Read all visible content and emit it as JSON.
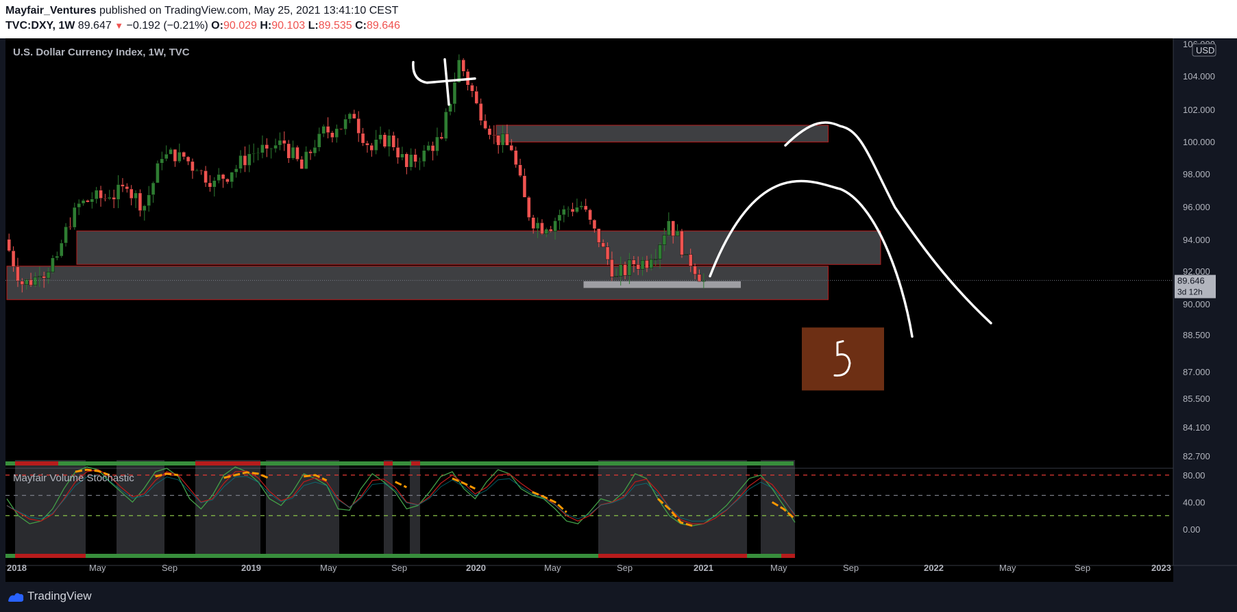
{
  "header": {
    "author": "Mayfair_Ventures",
    "published": " published on TradingView.com, May 25, 2021 13:41:10 CEST",
    "symbol": "TVC:DXY, 1W",
    "last": "89.647",
    "change_arrow": "▼",
    "change": "−0.192 (−0.21%)",
    "o_label": "O:",
    "o_value": "90.029",
    "h_label": "H:",
    "h_value": "90.103",
    "l_label": "L:",
    "l_value": "89.535",
    "c_label": "C:",
    "c_value": "89.646"
  },
  "chart_title": "U.S. Dollar Currency Index, 1W, TVC",
  "indicator_title": "Mayfair Volume Stochastic",
  "footer": {
    "brand": "TradingView"
  },
  "colors": {
    "background": "#131722",
    "up": "#26a69a",
    "up_candle": "#2e7d32",
    "down": "#ef5350",
    "zone_fill": "rgba(178,181,190,0.35)",
    "orange": "#ff9800",
    "brown_box": "#6d2f14"
  },
  "chart_data": [
    {
      "type": "candlestick",
      "title": "U.S. Dollar Currency Index, 1W, TVC",
      "currency": "USD",
      "y_ticks": [
        "106.000",
        "104.000",
        "102.000",
        "100.000",
        "98.000",
        "96.000",
        "94.000",
        "92.000",
        "90.000",
        "88.500",
        "87.000",
        "85.500",
        "84.100",
        "82.700"
      ],
      "x_ticks": [
        "2018",
        "May",
        "Sep",
        "2019",
        "May",
        "Sep",
        "2020",
        "May",
        "Sep",
        "2021",
        "May",
        "Sep",
        "2022",
        "May",
        "Sep",
        "2023"
      ],
      "last_price_label": "89.646",
      "countdown_label": "3d 12h",
      "weekly_close_path": [
        {
          "date": "2018-01",
          "close": 92.1
        },
        {
          "date": "2018-02",
          "close": 89.4
        },
        {
          "date": "2018-03",
          "close": 89.9
        },
        {
          "date": "2018-04",
          "close": 91.1
        },
        {
          "date": "2018-05",
          "close": 94.0
        },
        {
          "date": "2018-06",
          "close": 94.5
        },
        {
          "date": "2018-07",
          "close": 94.6
        },
        {
          "date": "2018-08",
          "close": 95.1
        },
        {
          "date": "2018-09",
          "close": 94.1
        },
        {
          "date": "2018-10",
          "close": 96.9
        },
        {
          "date": "2018-11",
          "close": 97.3
        },
        {
          "date": "2018-12",
          "close": 96.2
        },
        {
          "date": "2019-01",
          "close": 95.6
        },
        {
          "date": "2019-02",
          "close": 96.1
        },
        {
          "date": "2019-03",
          "close": 97.2
        },
        {
          "date": "2019-04",
          "close": 97.5
        },
        {
          "date": "2019-05",
          "close": 97.8
        },
        {
          "date": "2019-06",
          "close": 96.3
        },
        {
          "date": "2019-07",
          "close": 98.4
        },
        {
          "date": "2019-08",
          "close": 98.7
        },
        {
          "date": "2019-09",
          "close": 99.3
        },
        {
          "date": "2019-10",
          "close": 97.4
        },
        {
          "date": "2019-11",
          "close": 98.3
        },
        {
          "date": "2019-12",
          "close": 96.4
        },
        {
          "date": "2020-01",
          "close": 97.4
        },
        {
          "date": "2020-02",
          "close": 98.1
        },
        {
          "date": "2020-03",
          "close": 102.8
        },
        {
          "date": "2020-04",
          "close": 100.2
        },
        {
          "date": "2020-05",
          "close": 98.3
        },
        {
          "date": "2020-06",
          "close": 97.4
        },
        {
          "date": "2020-07",
          "close": 93.4
        },
        {
          "date": "2020-08",
          "close": 92.7
        },
        {
          "date": "2020-09",
          "close": 93.9
        },
        {
          "date": "2020-10",
          "close": 94.1
        },
        {
          "date": "2020-11",
          "close": 91.9
        },
        {
          "date": "2020-12",
          "close": 89.9
        },
        {
          "date": "2021-01",
          "close": 90.6
        },
        {
          "date": "2021-02",
          "close": 90.9
        },
        {
          "date": "2021-03",
          "close": 93.2
        },
        {
          "date": "2021-04",
          "close": 91.2
        },
        {
          "date": "2021-05",
          "close": 89.65
        }
      ],
      "zones": [
        {
          "from": "2020-05",
          "to": "2021-12",
          "low": 97.9,
          "high": 98.9
        },
        {
          "from": "2018-05",
          "to": "2022-03",
          "low": 90.6,
          "high": 92.6
        },
        {
          "from": "2018-01",
          "to": "2021-12",
          "low": 88.5,
          "high": 90.5
        },
        {
          "from": "2020-10",
          "to": "2021-07",
          "low": 89.2,
          "high": 89.6
        }
      ],
      "annotations": [
        {
          "text": "4",
          "date": "2020-03",
          "price": 101.6
        },
        {
          "text": "5",
          "date": "2021-06",
          "price": 84.8
        }
      ],
      "projections": [
        {
          "start": "2021-05",
          "peak": 95.1,
          "end_price": 86.3
        },
        {
          "start": "2021-05",
          "peak": 98.8,
          "end_price": 87.1
        }
      ]
    },
    {
      "type": "line",
      "title": "Mayfair Volume Stochastic",
      "y_ticks": [
        "80.00",
        "40.00",
        "0.00"
      ],
      "levels": [
        {
          "value": 80,
          "style": "red dashed"
        },
        {
          "value": 50,
          "style": "grey dashed"
        },
        {
          "value": 20,
          "style": "green dashed"
        }
      ],
      "series": [
        {
          "name": "",
          "values": [
            45,
            20,
            8,
            12,
            30,
            60,
            85,
            92,
            88,
            70,
            55,
            40,
            60,
            85,
            90,
            78,
            45,
            30,
            50,
            80,
            92,
            85,
            70,
            45,
            35,
            55,
            82,
            75,
            65,
            30,
            28,
            60,
            82,
            70,
            55,
            30,
            35,
            55,
            78,
            85,
            60,
            45,
            70,
            88,
            82,
            60,
            50,
            45,
            30,
            12,
            8,
            25,
            45,
            40,
            55,
            82,
            75,
            45,
            20,
            8,
            5,
            8,
            20,
            35,
            55,
            75,
            80,
            60,
            35,
            10
          ]
        },
        {
          "name": "",
          "values": [
            35,
            25,
            15,
            12,
            22,
            45,
            70,
            85,
            88,
            78,
            62,
            48,
            52,
            72,
            85,
            80,
            60,
            40,
            45,
            68,
            85,
            86,
            76,
            56,
            42,
            48,
            70,
            76,
            70,
            45,
            32,
            48,
            72,
            74,
            62,
            40,
            36,
            48,
            68,
            80,
            68,
            52,
            62,
            80,
            82,
            68,
            56,
            48,
            36,
            20,
            12,
            20,
            36,
            40,
            48,
            70,
            74,
            56,
            32,
            14,
            8,
            8,
            16,
            28,
            45,
            64,
            76,
            66,
            45,
            20
          ]
        },
        {
          "name": "",
          "values": [
            null,
            null,
            null,
            null,
            null,
            null,
            85,
            88,
            86,
            80,
            null,
            null,
            null,
            78,
            82,
            80,
            null,
            null,
            null,
            76,
            80,
            84,
            82,
            75,
            null,
            null,
            78,
            80,
            72,
            null,
            null,
            null,
            null,
            null,
            70,
            62,
            null,
            null,
            null,
            75,
            68,
            60,
            null,
            null,
            null,
            null,
            55,
            48,
            40,
            25,
            null,
            null,
            null,
            null,
            null,
            null,
            null,
            45,
            30,
            10,
            5,
            null,
            null,
            null,
            null,
            null,
            null,
            40,
            30,
            15
          ]
        }
      ]
    }
  ]
}
